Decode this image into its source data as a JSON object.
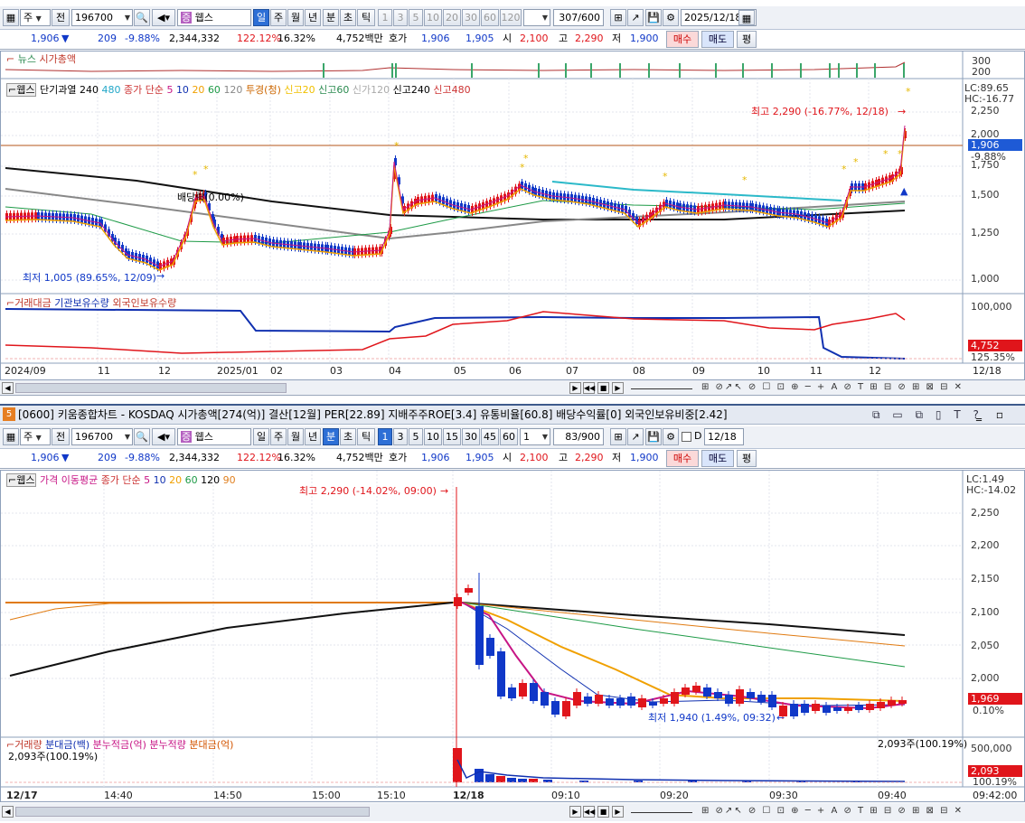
{
  "top": {
    "toolbar": {
      "type_sel": "주",
      "jeon": "전",
      "code": "196700",
      "search_icon": "search-icon",
      "sound_icon": "speaker-icon",
      "jeung": "증",
      "stock": "웹스",
      "periods": [
        "일",
        "주",
        "월",
        "년",
        "분",
        "초",
        "틱"
      ],
      "active_period": "일",
      "nums": [
        "1",
        "3",
        "5",
        "10",
        "20",
        "30",
        "60",
        "120"
      ],
      "count": "307",
      "count_total": "/600",
      "date": "2025/12/18"
    },
    "quote": {
      "price": "1,906",
      "arrow": "▼",
      "change": "209",
      "rate": "-9.88%",
      "volume": "2,344,332",
      "vol_ratio": "122.12%",
      "turnover": "16.32%",
      "amount": "4,752백만",
      "hoga_label": "호가",
      "ask": "1,906",
      "bid": "1,905",
      "open_label": "시",
      "open": "2,100",
      "high_label": "고",
      "high": "2,290",
      "low_label": "저",
      "low": "1,900",
      "buy": "매수",
      "sell": "매도",
      "eval": "평"
    },
    "news": {
      "title": "뉴스",
      "mcap_label": "시가총액",
      "ticks": [
        "300",
        "200"
      ]
    },
    "main": {
      "legend": {
        "name": "웹스",
        "ind1": "단기과열",
        "p240": "240",
        "p480": "480",
        "ma_label": "종가 단순",
        "periods": [
          "5",
          "10",
          "20",
          "60",
          "120"
        ],
        "ind2": "투경(청)",
        "ind3": "신고20",
        "ind4": "신고60",
        "ind5": "신가120",
        "ind6": "신고240",
        "ind7": "신고480"
      },
      "lc": "LC:89.65",
      "hc": "HC:-16.77",
      "yticks": [
        "2,250",
        "2,000",
        "1,750",
        "1,500",
        "1,250",
        "1,000"
      ],
      "price_tag": "1,906",
      "rate_tag": "-9.88%",
      "high_ann": "최고 2,290 (-16.77%, 12/18)",
      "low_ann": "최저 1,005 (89.65%, 12/09)",
      "bae_ann": "배당락(0.00%)"
    },
    "sub": {
      "legend": [
        "거래대금",
        "기관보유수량",
        "외국인보유수량"
      ],
      "ytick": "100,000",
      "tag1": "4,752",
      "tag2": "125.35%"
    },
    "xaxis": {
      "labels": [
        "2024/09",
        "11",
        "12",
        "2025/01",
        "02",
        "03",
        "04",
        "05",
        "06",
        "07",
        "08",
        "09",
        "10",
        "11",
        "12"
      ],
      "right": "12/18"
    }
  },
  "window2": {
    "title": "[0600] 키움종합차트 - KOSDAQ 시가총액[274(억)] 결산[12월] PER[22.89] 지배주주ROE[3.4] 유통비율[60.8] 배당수익률[0] 외국인보유비중[2.42]",
    "badge": "5"
  },
  "bottom": {
    "toolbar": {
      "type_sel": "주",
      "jeon": "전",
      "code": "196700",
      "jeung": "증",
      "stock": "웹스",
      "periods": [
        "일",
        "주",
        "월",
        "년",
        "분",
        "초",
        "틱"
      ],
      "active_period": "분",
      "nums": [
        "1",
        "3",
        "5",
        "10",
        "15",
        "30",
        "45",
        "60"
      ],
      "unit": "1",
      "count": "83",
      "count_total": "/900",
      "d_label": "D",
      "date": "12/18"
    },
    "quote": {
      "price": "1,906",
      "arrow": "▼",
      "change": "209",
      "rate": "-9.88%",
      "volume": "2,344,332",
      "vol_ratio": "122.12%",
      "turnover": "16.32%",
      "amount": "4,752백만",
      "hoga_label": "호가",
      "ask": "1,906",
      "bid": "1,905",
      "open_label": "시",
      "open": "2,100",
      "high_label": "고",
      "high": "2,290",
      "low_label": "저",
      "low": "1,900",
      "buy": "매수",
      "sell": "매도",
      "eval": "평"
    },
    "main": {
      "legend": {
        "name": "웹스",
        "ind1": "가격 이동평균",
        "ma_label": "종가 단순",
        "periods": [
          "5",
          "10",
          "20",
          "60",
          "120",
          "90"
        ]
      },
      "lc": "LC:1.49",
      "hc": "HC:-14.02",
      "yticks": [
        "2,250",
        "2,200",
        "2,150",
        "2,100",
        "2,050",
        "2,000",
        "1,950"
      ],
      "price_tag": "1,969",
      "rate_tag": "0.10%",
      "high_ann": "최고 2,290 (-14.02%, 09:00)",
      "low_ann": "최저 1,940 (1.49%, 09:32)"
    },
    "sub": {
      "legend": [
        "거래량",
        "분대금(백)",
        "분누적금(억)",
        "분누적량",
        "분대금(억)"
      ],
      "left_label": "2,093주(100.19%)",
      "right_label": "2,093주(100.19%)",
      "ytick": "500,000",
      "tag1": "2,093",
      "tag2": "100.19%"
    },
    "xaxis": {
      "labels": [
        "12/17",
        "14:40",
        "14:50",
        "15:00",
        "15:10",
        "12/18",
        "09:10",
        "09:20",
        "09:30",
        "09:40"
      ],
      "right": "09:42:00"
    }
  },
  "colors": {
    "up": "#e0151b",
    "down": "#1038c8",
    "accent": "#2d6fd6"
  }
}
